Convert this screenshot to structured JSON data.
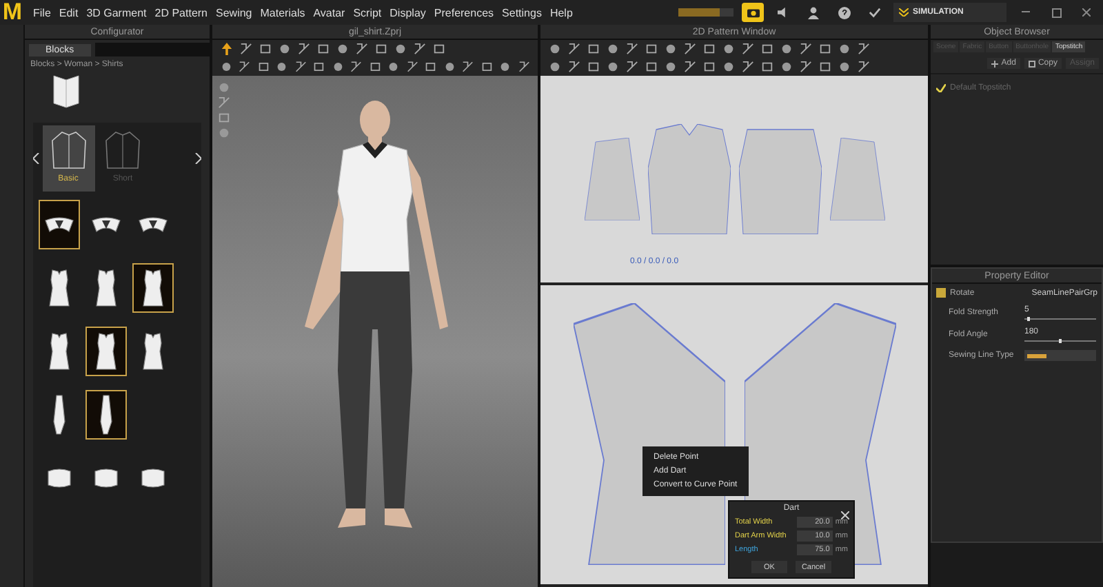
{
  "menu": {
    "logo": "M",
    "items": [
      "File",
      "Edit",
      "3D Garment",
      "2D Pattern",
      "Sewing",
      "Materials",
      "Avatar",
      "Script",
      "Display",
      "Preferences",
      "Settings",
      "Help"
    ],
    "mode": "SIMULATION",
    "progress": {
      "level": 0.75
    }
  },
  "configurator": {
    "title": "Configurator",
    "tab": "Blocks",
    "breadcrumb": "Blocks > Woman > Shirts",
    "styles": [
      {
        "label": "Basic",
        "selected": true
      },
      {
        "label": "Short",
        "selected": false
      }
    ],
    "parts": [
      [
        {
          "kind": "collar",
          "selected": true
        },
        {
          "kind": "collar",
          "selected": false
        },
        {
          "kind": "collar",
          "selected": false
        }
      ],
      [
        {
          "kind": "front",
          "selected": false
        },
        {
          "kind": "front",
          "selected": false
        },
        {
          "kind": "front",
          "selected": true
        }
      ],
      [
        {
          "kind": "front",
          "selected": false
        },
        {
          "kind": "front",
          "selected": true
        },
        {
          "kind": "front",
          "selected": false
        }
      ],
      [
        {
          "kind": "sleeve",
          "selected": false
        },
        {
          "kind": "sleeve",
          "selected": true
        }
      ],
      [
        {
          "kind": "cuff",
          "selected": false
        },
        {
          "kind": "cuff",
          "selected": false
        },
        {
          "kind": "cuff",
          "selected": false
        }
      ]
    ]
  },
  "viewport": {
    "title": "gil_shirt.Zprj"
  },
  "pattern_window": {
    "title": "2D Pattern Window",
    "measure": "0.0 / 0.0 / 0.0",
    "context_menu": [
      "Delete Point",
      "Add Dart",
      "Convert to Curve Point"
    ],
    "dart_dialog": {
      "title": "Dart",
      "fields": [
        {
          "label": "Total Width",
          "value": "20.0",
          "unit": "mm",
          "color": "#e3d24a"
        },
        {
          "label": "Dart Arm Width",
          "value": "10.0",
          "unit": "mm",
          "color": "#e3d24a"
        },
        {
          "label": "Length",
          "value": "75.0",
          "unit": "mm",
          "color": "#3fa7e0"
        }
      ],
      "buttons": [
        "OK",
        "Cancel"
      ]
    }
  },
  "object_browser": {
    "title": "Object Browser",
    "tabs": [
      {
        "label": "Scene",
        "selected": false
      },
      {
        "label": "Fabric",
        "selected": false
      },
      {
        "label": "Button",
        "selected": false
      },
      {
        "label": "Buttonhole",
        "selected": false
      },
      {
        "label": "Topstitch",
        "selected": true
      }
    ],
    "actions": [
      {
        "label": "Add",
        "kind": "add",
        "disabled": false
      },
      {
        "label": "Copy",
        "kind": "copy",
        "disabled": false
      },
      {
        "label": "Assign",
        "kind": "assign",
        "disabled": true
      }
    ],
    "items": [
      {
        "label": "Default Topstitch",
        "checked": true
      }
    ]
  },
  "property_editor": {
    "title": "Property Editor",
    "header": {
      "label": "Rotate",
      "checked": true,
      "value": "SeamLinePairGrp"
    },
    "rows": [
      {
        "kind": "slider",
        "label": "Fold Strength",
        "value": "5",
        "level": 0.05
      },
      {
        "kind": "slider",
        "label": "Fold Angle",
        "value": "180",
        "level": 0.5
      },
      {
        "kind": "select",
        "label": "Sewing Line Type"
      }
    ]
  }
}
